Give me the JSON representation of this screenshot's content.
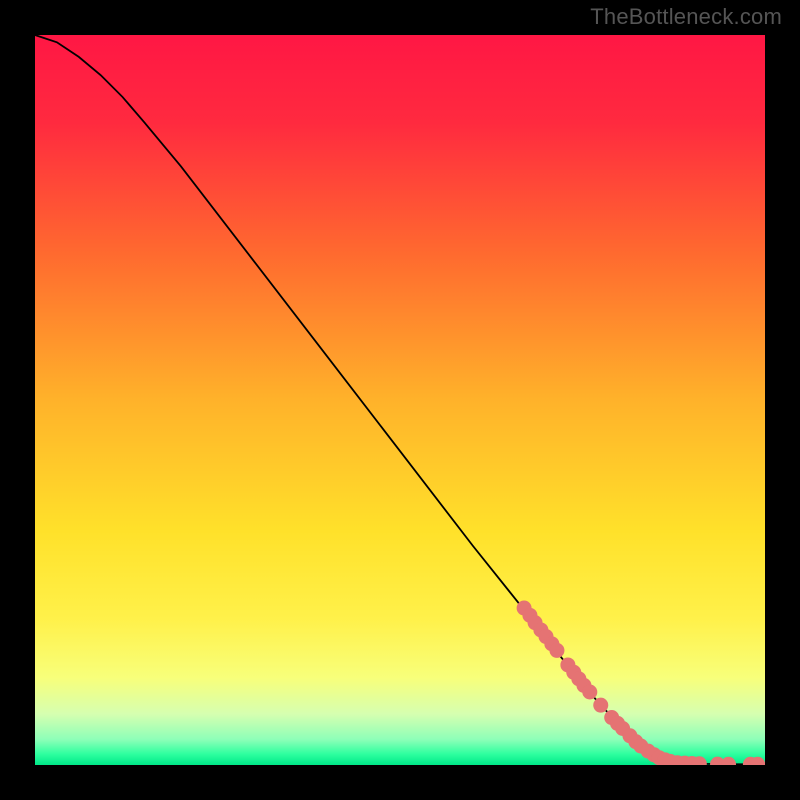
{
  "watermark": "TheBottleneck.com",
  "chart_data": {
    "type": "line",
    "title": "",
    "xlabel": "",
    "ylabel": "",
    "xlim": [
      0,
      100
    ],
    "ylim": [
      0,
      100
    ],
    "background_gradient": {
      "stops": [
        {
          "offset": 0.0,
          "color": "#ff1744"
        },
        {
          "offset": 0.12,
          "color": "#ff2a3f"
        },
        {
          "offset": 0.3,
          "color": "#ff6a2f"
        },
        {
          "offset": 0.5,
          "color": "#ffb22a"
        },
        {
          "offset": 0.68,
          "color": "#ffe12a"
        },
        {
          "offset": 0.8,
          "color": "#fff14a"
        },
        {
          "offset": 0.88,
          "color": "#f8ff7a"
        },
        {
          "offset": 0.93,
          "color": "#d6ffb0"
        },
        {
          "offset": 0.965,
          "color": "#8dffb8"
        },
        {
          "offset": 0.985,
          "color": "#2eff9f"
        },
        {
          "offset": 1.0,
          "color": "#00e888"
        }
      ]
    },
    "series": [
      {
        "name": "curve",
        "color": "#000000",
        "width": 1.8,
        "points": [
          {
            "x": 0,
            "y": 100
          },
          {
            "x": 3,
            "y": 99
          },
          {
            "x": 6,
            "y": 97
          },
          {
            "x": 9,
            "y": 94.5
          },
          {
            "x": 12,
            "y": 91.5
          },
          {
            "x": 15,
            "y": 88
          },
          {
            "x": 20,
            "y": 82
          },
          {
            "x": 30,
            "y": 69
          },
          {
            "x": 40,
            "y": 56
          },
          {
            "x": 50,
            "y": 43
          },
          {
            "x": 60,
            "y": 30
          },
          {
            "x": 68,
            "y": 20
          },
          {
            "x": 75,
            "y": 11
          },
          {
            "x": 80,
            "y": 5.5
          },
          {
            "x": 83,
            "y": 2.5
          },
          {
            "x": 85,
            "y": 1.2
          },
          {
            "x": 88,
            "y": 0.4
          },
          {
            "x": 92,
            "y": 0.15
          },
          {
            "x": 96,
            "y": 0.1
          },
          {
            "x": 100,
            "y": 0.1
          }
        ]
      }
    ],
    "scatter": {
      "name": "markers",
      "color": "#e57373",
      "radius": 7.5,
      "points": [
        {
          "x": 67,
          "y": 21.5
        },
        {
          "x": 67.8,
          "y": 20.5
        },
        {
          "x": 68.5,
          "y": 19.5
        },
        {
          "x": 69.3,
          "y": 18.5
        },
        {
          "x": 70,
          "y": 17.6
        },
        {
          "x": 70.8,
          "y": 16.6
        },
        {
          "x": 71.5,
          "y": 15.7
        },
        {
          "x": 73,
          "y": 13.7
        },
        {
          "x": 73.8,
          "y": 12.7
        },
        {
          "x": 74.5,
          "y": 11.8
        },
        {
          "x": 75.2,
          "y": 10.9
        },
        {
          "x": 76,
          "y": 10
        },
        {
          "x": 77.5,
          "y": 8.2
        },
        {
          "x": 79,
          "y": 6.5
        },
        {
          "x": 79.8,
          "y": 5.7
        },
        {
          "x": 80.5,
          "y": 5
        },
        {
          "x": 81.5,
          "y": 4
        },
        {
          "x": 82.3,
          "y": 3.2
        },
        {
          "x": 83,
          "y": 2.6
        },
        {
          "x": 84,
          "y": 1.9
        },
        {
          "x": 84.8,
          "y": 1.4
        },
        {
          "x": 85.5,
          "y": 1
        },
        {
          "x": 86.3,
          "y": 0.7
        },
        {
          "x": 87,
          "y": 0.5
        },
        {
          "x": 88,
          "y": 0.3
        },
        {
          "x": 89,
          "y": 0.25
        },
        {
          "x": 90,
          "y": 0.2
        },
        {
          "x": 91,
          "y": 0.17
        },
        {
          "x": 93.5,
          "y": 0.12
        },
        {
          "x": 95,
          "y": 0.1
        },
        {
          "x": 98,
          "y": 0.1
        },
        {
          "x": 99,
          "y": 0.1
        }
      ]
    }
  }
}
